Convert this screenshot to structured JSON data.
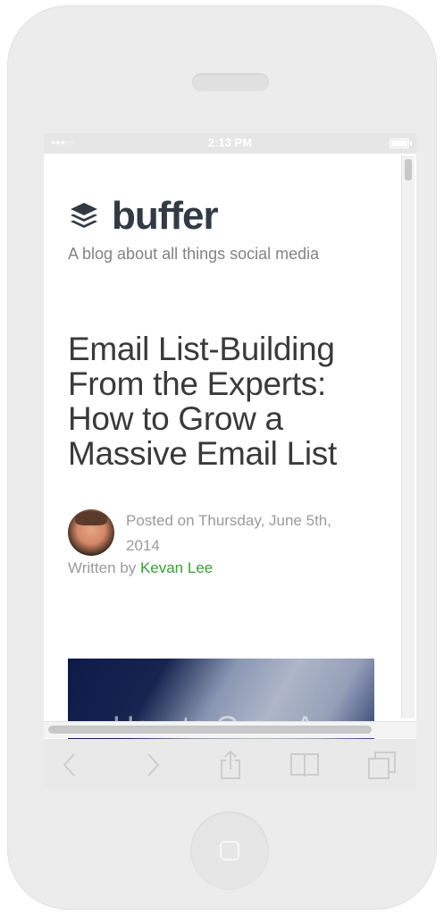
{
  "status_bar": {
    "signal": "●●●○○",
    "time": "2:13 PM",
    "battery_icon": "battery-icon"
  },
  "blog": {
    "logo_text": "buffer",
    "logo_icon": "layers-stack-icon",
    "tagline": "A blog about all things social media"
  },
  "article": {
    "title": "Email List-Building From the Experts: How to Grow a Massive Email List",
    "posted_on": "Posted on Thursday, June 5th, 2014",
    "written_by_prefix": "Written by ",
    "author": "Kevan Lee",
    "hero_text": "How to Grow A"
  },
  "toolbar": {
    "back_icon": "chevron-left-icon",
    "forward_icon": "chevron-right-icon",
    "share_icon": "share-icon",
    "bookmarks_icon": "book-icon",
    "tabs_icon": "tabs-icon"
  },
  "colors": {
    "author_link": "#3d9b3a",
    "logo": "#323b43",
    "title": "#3a3a3a"
  }
}
